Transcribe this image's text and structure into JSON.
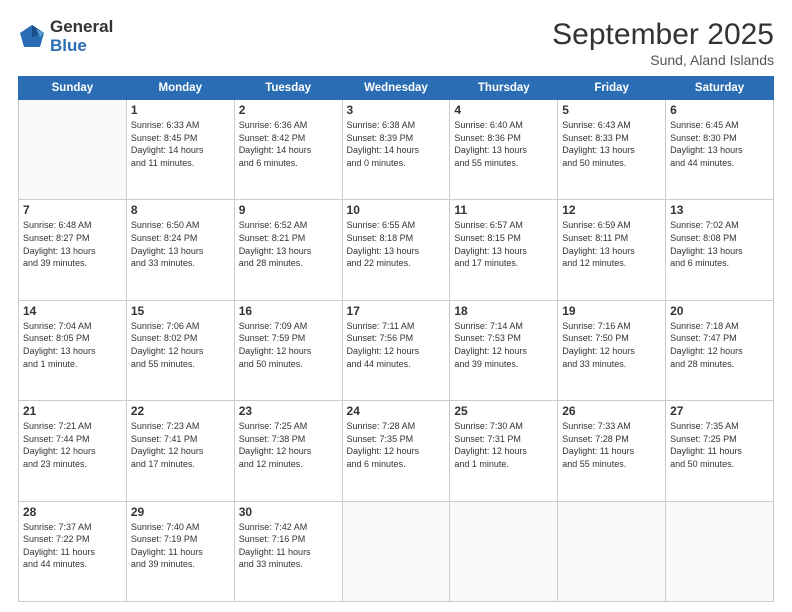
{
  "header": {
    "logo_general": "General",
    "logo_blue": "Blue",
    "month_title": "September 2025",
    "location": "Sund, Aland Islands"
  },
  "days_of_week": [
    "Sunday",
    "Monday",
    "Tuesday",
    "Wednesday",
    "Thursday",
    "Friday",
    "Saturday"
  ],
  "weeks": [
    [
      {
        "day": "",
        "info": ""
      },
      {
        "day": "1",
        "info": "Sunrise: 6:33 AM\nSunset: 8:45 PM\nDaylight: 14 hours\nand 11 minutes."
      },
      {
        "day": "2",
        "info": "Sunrise: 6:36 AM\nSunset: 8:42 PM\nDaylight: 14 hours\nand 6 minutes."
      },
      {
        "day": "3",
        "info": "Sunrise: 6:38 AM\nSunset: 8:39 PM\nDaylight: 14 hours\nand 0 minutes."
      },
      {
        "day": "4",
        "info": "Sunrise: 6:40 AM\nSunset: 8:36 PM\nDaylight: 13 hours\nand 55 minutes."
      },
      {
        "day": "5",
        "info": "Sunrise: 6:43 AM\nSunset: 8:33 PM\nDaylight: 13 hours\nand 50 minutes."
      },
      {
        "day": "6",
        "info": "Sunrise: 6:45 AM\nSunset: 8:30 PM\nDaylight: 13 hours\nand 44 minutes."
      }
    ],
    [
      {
        "day": "7",
        "info": "Sunrise: 6:48 AM\nSunset: 8:27 PM\nDaylight: 13 hours\nand 39 minutes."
      },
      {
        "day": "8",
        "info": "Sunrise: 6:50 AM\nSunset: 8:24 PM\nDaylight: 13 hours\nand 33 minutes."
      },
      {
        "day": "9",
        "info": "Sunrise: 6:52 AM\nSunset: 8:21 PM\nDaylight: 13 hours\nand 28 minutes."
      },
      {
        "day": "10",
        "info": "Sunrise: 6:55 AM\nSunset: 8:18 PM\nDaylight: 13 hours\nand 22 minutes."
      },
      {
        "day": "11",
        "info": "Sunrise: 6:57 AM\nSunset: 8:15 PM\nDaylight: 13 hours\nand 17 minutes."
      },
      {
        "day": "12",
        "info": "Sunrise: 6:59 AM\nSunset: 8:11 PM\nDaylight: 13 hours\nand 12 minutes."
      },
      {
        "day": "13",
        "info": "Sunrise: 7:02 AM\nSunset: 8:08 PM\nDaylight: 13 hours\nand 6 minutes."
      }
    ],
    [
      {
        "day": "14",
        "info": "Sunrise: 7:04 AM\nSunset: 8:05 PM\nDaylight: 13 hours\nand 1 minute."
      },
      {
        "day": "15",
        "info": "Sunrise: 7:06 AM\nSunset: 8:02 PM\nDaylight: 12 hours\nand 55 minutes."
      },
      {
        "day": "16",
        "info": "Sunrise: 7:09 AM\nSunset: 7:59 PM\nDaylight: 12 hours\nand 50 minutes."
      },
      {
        "day": "17",
        "info": "Sunrise: 7:11 AM\nSunset: 7:56 PM\nDaylight: 12 hours\nand 44 minutes."
      },
      {
        "day": "18",
        "info": "Sunrise: 7:14 AM\nSunset: 7:53 PM\nDaylight: 12 hours\nand 39 minutes."
      },
      {
        "day": "19",
        "info": "Sunrise: 7:16 AM\nSunset: 7:50 PM\nDaylight: 12 hours\nand 33 minutes."
      },
      {
        "day": "20",
        "info": "Sunrise: 7:18 AM\nSunset: 7:47 PM\nDaylight: 12 hours\nand 28 minutes."
      }
    ],
    [
      {
        "day": "21",
        "info": "Sunrise: 7:21 AM\nSunset: 7:44 PM\nDaylight: 12 hours\nand 23 minutes."
      },
      {
        "day": "22",
        "info": "Sunrise: 7:23 AM\nSunset: 7:41 PM\nDaylight: 12 hours\nand 17 minutes."
      },
      {
        "day": "23",
        "info": "Sunrise: 7:25 AM\nSunset: 7:38 PM\nDaylight: 12 hours\nand 12 minutes."
      },
      {
        "day": "24",
        "info": "Sunrise: 7:28 AM\nSunset: 7:35 PM\nDaylight: 12 hours\nand 6 minutes."
      },
      {
        "day": "25",
        "info": "Sunrise: 7:30 AM\nSunset: 7:31 PM\nDaylight: 12 hours\nand 1 minute."
      },
      {
        "day": "26",
        "info": "Sunrise: 7:33 AM\nSunset: 7:28 PM\nDaylight: 11 hours\nand 55 minutes."
      },
      {
        "day": "27",
        "info": "Sunrise: 7:35 AM\nSunset: 7:25 PM\nDaylight: 11 hours\nand 50 minutes."
      }
    ],
    [
      {
        "day": "28",
        "info": "Sunrise: 7:37 AM\nSunset: 7:22 PM\nDaylight: 11 hours\nand 44 minutes."
      },
      {
        "day": "29",
        "info": "Sunrise: 7:40 AM\nSunset: 7:19 PM\nDaylight: 11 hours\nand 39 minutes."
      },
      {
        "day": "30",
        "info": "Sunrise: 7:42 AM\nSunset: 7:16 PM\nDaylight: 11 hours\nand 33 minutes."
      },
      {
        "day": "",
        "info": ""
      },
      {
        "day": "",
        "info": ""
      },
      {
        "day": "",
        "info": ""
      },
      {
        "day": "",
        "info": ""
      }
    ]
  ]
}
